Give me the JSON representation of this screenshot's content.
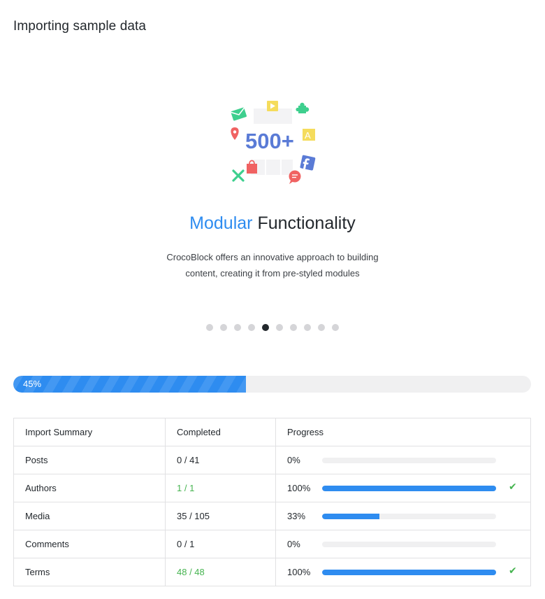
{
  "header": {
    "title": "Importing sample data"
  },
  "slide": {
    "badge": "500+",
    "heading_accent": "Modular",
    "heading_rest": "Functionality",
    "description_line1": "CrocoBlock offers an innovative approach to building",
    "description_line2": "content, creating it from pre-styled modules"
  },
  "carousel": {
    "count": 10,
    "active_index": 4
  },
  "progress": {
    "percent": 45,
    "label": "45%",
    "color": "#2e8cf0"
  },
  "summary": {
    "headers": [
      "Import Summary",
      "Completed",
      "Progress"
    ],
    "rows": [
      {
        "name": "Posts",
        "completed": "0 / 41",
        "percent_label": "0%",
        "percent": 0,
        "done": false
      },
      {
        "name": "Authors",
        "completed": "1 / 1",
        "percent_label": "100%",
        "percent": 100,
        "done": true
      },
      {
        "name": "Media",
        "completed": "35 / 105",
        "percent_label": "33%",
        "percent": 33,
        "done": false
      },
      {
        "name": "Comments",
        "completed": "0 / 1",
        "percent_label": "0%",
        "percent": 0,
        "done": false
      },
      {
        "name": "Terms",
        "completed": "48 / 48",
        "percent_label": "100%",
        "percent": 100,
        "done": true
      }
    ],
    "done_color": "#46b450"
  },
  "icons": [
    "envelope-icon",
    "play-icon",
    "puzzle-icon",
    "map-pin-icon",
    "font-icon",
    "shopping-bag-icon",
    "facebook-icon",
    "tools-icon",
    "chat-bubble-icon",
    "checkmark-icon"
  ]
}
